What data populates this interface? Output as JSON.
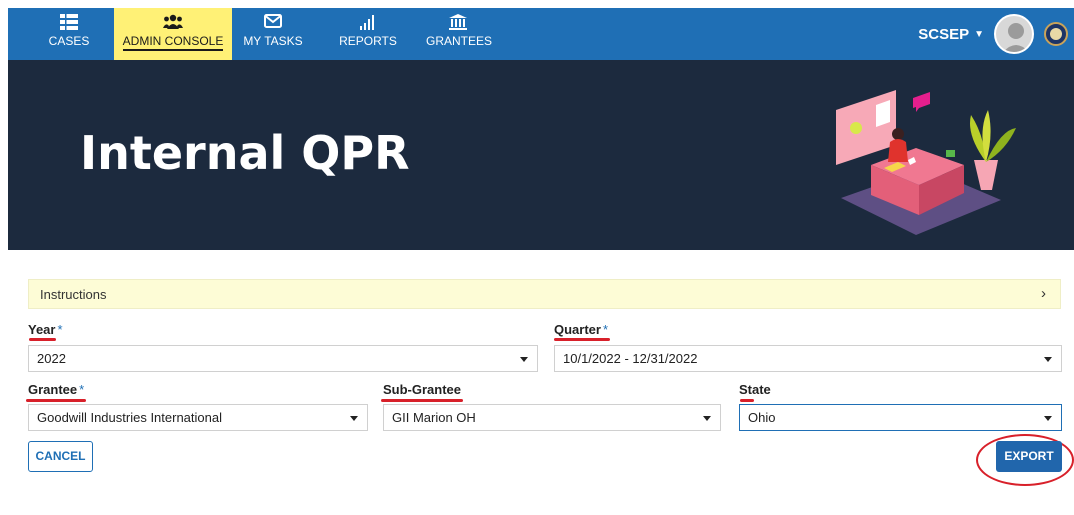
{
  "nav": {
    "items": [
      {
        "label": "CASES",
        "icon": "list-icon"
      },
      {
        "label": "ADMIN CONSOLE",
        "icon": "users-icon",
        "active": true
      },
      {
        "label": "MY TASKS",
        "icon": "envelope-icon"
      },
      {
        "label": "REPORTS",
        "icon": "bar-signal-icon"
      },
      {
        "label": "GRANTEES",
        "icon": "bank-icon"
      }
    ],
    "user_name": "SCSEP"
  },
  "hero": {
    "title": "Internal QPR"
  },
  "instructions": {
    "label": "Instructions"
  },
  "form": {
    "year": {
      "label": "Year",
      "value": "2022"
    },
    "quarter": {
      "label": "Quarter",
      "value": "10/1/2022 - 12/31/2022"
    },
    "grantee": {
      "label": "Grantee",
      "value": "Goodwill Industries International"
    },
    "sub_grantee": {
      "label": "Sub-Grantee",
      "value": "GII Marion OH"
    },
    "state": {
      "label": "State",
      "value": "Ohio"
    },
    "required_mark": "*"
  },
  "actions": {
    "cancel": "CANCEL",
    "export": "EXPORT"
  },
  "colors": {
    "nav": "#1f6fb5",
    "active_tab": "#fff176",
    "hero": "#1c2a3e",
    "annotation": "#d8202a",
    "export": "#2166ac"
  }
}
